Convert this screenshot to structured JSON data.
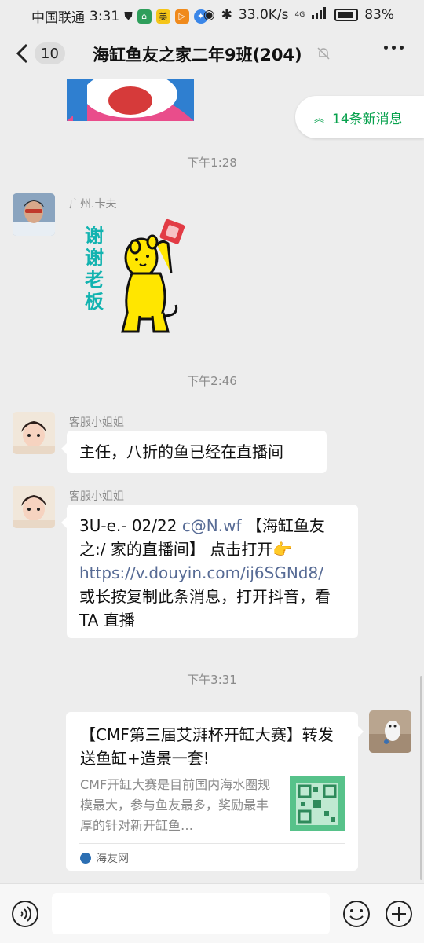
{
  "status_bar": {
    "carrier": "中国联通",
    "time": "3:31",
    "app_meituan": "美",
    "network_speed": "33.0K/s",
    "signal": "4G",
    "battery": "83%"
  },
  "header": {
    "unread_count": "10",
    "title": "海缸鱼友之家二年9班(204)"
  },
  "new_messages": "14条新消息",
  "messages": [
    {
      "type": "time",
      "text": "下午1:28"
    },
    {
      "type": "sticker",
      "sender": "广州.卡夫",
      "sticker_text": "谢谢老板"
    },
    {
      "type": "time",
      "text": "下午2:46"
    },
    {
      "type": "text",
      "sender": "客服小姐姐",
      "text": "主任，八折的鱼已经在直播间"
    },
    {
      "type": "text",
      "sender": "客服小姐姐",
      "part1": "3U-e.- 02/22 ",
      "mention": "c@N.wf",
      "part2": " 【海缸鱼友之:/ 家的直播间】  点击打开👉",
      "url": "https://v.douyin.com/ij6SGNd8/",
      "part3": "或长按复制此条消息，打开抖音，看 TA 直播"
    },
    {
      "type": "time",
      "text": "下午3:31"
    },
    {
      "type": "card",
      "title": "【CMF第三届艾湃杯开缸大赛】转发送鱼缸+造景一套!",
      "description": "CMF开缸大赛是目前国内海水圈规模最大，参与鱼友最多，奖励最丰厚的针对新开缸鱼…",
      "source": "海友网"
    }
  ],
  "colors": {
    "background": "#ededed",
    "accent_green": "#07a14d",
    "link": "#576b95"
  }
}
